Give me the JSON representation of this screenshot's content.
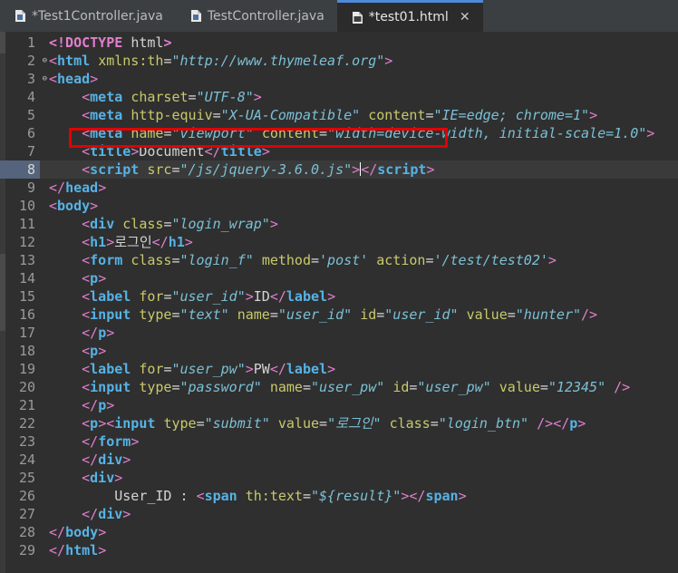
{
  "tabs": [
    {
      "label": "*Test1Controller.java",
      "icon": "java-file-icon",
      "active": false
    },
    {
      "label": "TestController.java",
      "icon": "java-file-icon",
      "active": false
    },
    {
      "label": "*test01.html",
      "icon": "html-file-icon",
      "active": true,
      "close": "✕"
    }
  ],
  "editor": {
    "current_line": 8,
    "highlighted_line": 8,
    "lines": [
      {
        "n": "1"
      },
      {
        "n": "2"
      },
      {
        "n": "3"
      },
      {
        "n": "4"
      },
      {
        "n": "5"
      },
      {
        "n": "6"
      },
      {
        "n": "7"
      },
      {
        "n": "8"
      },
      {
        "n": "9"
      },
      {
        "n": "10"
      },
      {
        "n": "11"
      },
      {
        "n": "12"
      },
      {
        "n": "13"
      },
      {
        "n": "14"
      },
      {
        "n": "15"
      },
      {
        "n": "16"
      },
      {
        "n": "17"
      },
      {
        "n": "18"
      },
      {
        "n": "19"
      },
      {
        "n": "20"
      },
      {
        "n": "21"
      },
      {
        "n": "22"
      },
      {
        "n": "23"
      },
      {
        "n": "24"
      },
      {
        "n": "25"
      },
      {
        "n": "26"
      },
      {
        "n": "27"
      },
      {
        "n": "28"
      },
      {
        "n": "29"
      }
    ],
    "text": {
      "doctype": "<!DOCTYPE",
      "html_kw": "html",
      "gt": ">",
      "lt": "<",
      "ltslash": "</",
      "selfclose": "/>",
      "eq": "=",
      "html_tag": "html",
      "head_tag": "head",
      "body_tag": "body",
      "meta_tag": "meta",
      "title_tag": "title",
      "script_tag": "script",
      "div_tag": "div",
      "h1_tag": "h1",
      "form_tag": "form",
      "p_tag": "p",
      "label_tag": "label",
      "input_tag": "input",
      "span_tag": "span",
      "xmlns_attr": "xmlns:th",
      "xmlns_val": "\"http://www.thymeleaf.org\"",
      "charset_attr": "charset",
      "charset_val": "\"UTF-8\"",
      "http_equiv_attr": "http-equiv",
      "http_equiv_val": "\"X-UA-Compatible\"",
      "content_attr": "content",
      "content_val1": "\"IE=edge; chrome=1\"",
      "name_attr": "name",
      "viewport_val": "\"viewport\"",
      "content_val2": "\"width=device-width, initial-scale=1.0\"",
      "title_text": "Document",
      "src_attr": "src",
      "src_val": "\"/js/jquery-3.6.0.js\"",
      "class_attr": "class",
      "login_wrap_val": "\"login_wrap\"",
      "h1_text": "로그인",
      "login_f_val": "\"login_f\"",
      "method_attr": "method",
      "method_val": "'post'",
      "action_attr": "action",
      "action_val": "'/test/test02'",
      "for_attr": "for",
      "user_id_val": "\"user_id\"",
      "id_text": "ID",
      "type_attr": "type",
      "text_val": "\"text\"",
      "id_attr": "id",
      "value_attr": "value",
      "hunter_val": "\"hunter\"",
      "user_pw_val": "\"user_pw\"",
      "pw_text": "PW",
      "password_val": "\"password\"",
      "pw_value_val": "\"12345\"",
      "submit_val": "\"submit\"",
      "submit_label_val": "\"로그인\"",
      "login_btn_val": "\"login_btn\"",
      "user_id_label": "User_ID : ",
      "th_text_attr": "th:text",
      "result_val": "\"${result}\""
    }
  }
}
